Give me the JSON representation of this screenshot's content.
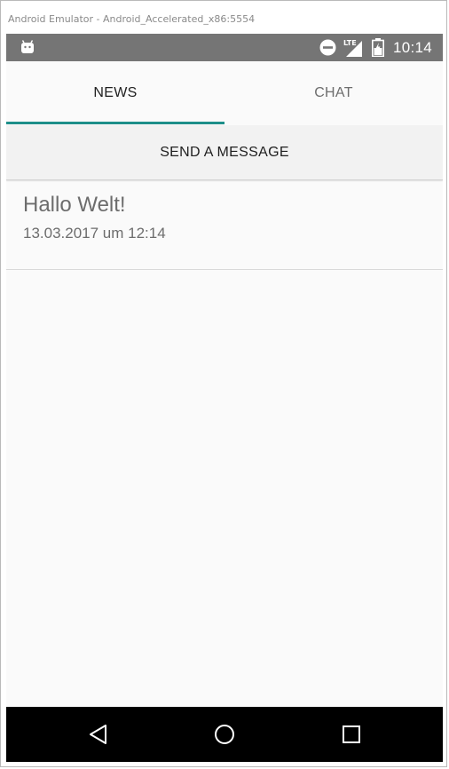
{
  "window": {
    "title": "Android Emulator - Android_Accelerated_x86:5554"
  },
  "status_bar": {
    "time": "10:14",
    "network_type": "LTE",
    "icons": [
      "android-icon",
      "do-not-disturb-icon",
      "signal-icon",
      "battery-icon"
    ],
    "background_color": "#757575"
  },
  "tabs": [
    {
      "label": "NEWS",
      "selected": true
    },
    {
      "label": "CHAT",
      "selected": false
    }
  ],
  "accent_color": "#1e8f8a",
  "send_button": {
    "label": "SEND A MESSAGE"
  },
  "news": [
    {
      "title": "Hallo Welt!",
      "date": "13.03.2017 um 12:14"
    }
  ],
  "nav_bar": {
    "buttons": [
      "back-icon",
      "home-icon",
      "recent-apps-icon"
    ]
  }
}
